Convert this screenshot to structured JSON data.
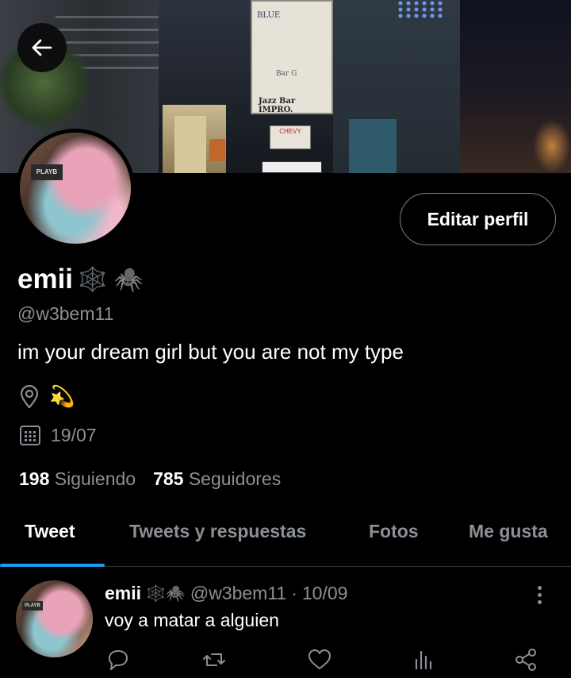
{
  "header": {
    "back_label": "Back"
  },
  "banner": {
    "sign_top": "BLUE",
    "sign_bottom": "Jazz Bar IMPRO.",
    "sign_mid": "Bar G",
    "chevy": "CHEVY",
    "playbill": "PLAYB"
  },
  "profile": {
    "edit_label": "Editar perfil",
    "name": "emii",
    "name_emoji": "🕸️ 🕷️",
    "handle": "@w3bem11",
    "bio": "im your dream girl but you are not my type",
    "location_emoji": "💫",
    "joined": "19/07",
    "following_count": "198",
    "following_label": "Siguiendo",
    "followers_count": "785",
    "followers_label": "Seguidores"
  },
  "tabs": [
    {
      "label": "Tweet"
    },
    {
      "label": "Tweets y respuestas"
    },
    {
      "label": "Fotos"
    },
    {
      "label": "Me gusta"
    }
  ],
  "tweet": {
    "name": "emii",
    "emoji": "🕸️🕷️",
    "handle": "@w3bem11",
    "sep": "·",
    "date": "10/09",
    "text": "voy a matar a alguien",
    "playbill": "PLAYB"
  },
  "colors": {
    "accent": "#1d9bf0",
    "muted": "#8b9096",
    "background": "#000000"
  }
}
